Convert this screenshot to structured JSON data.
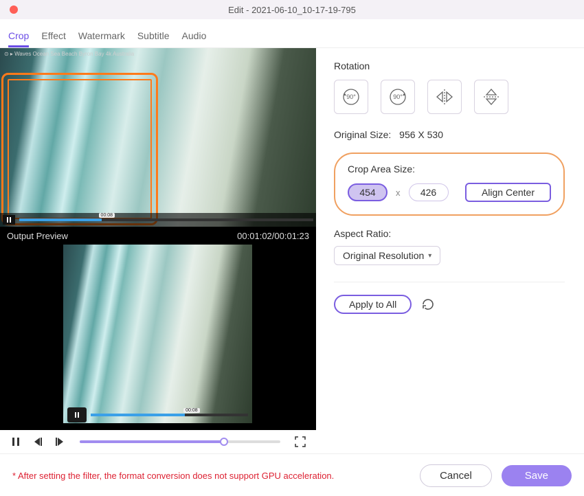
{
  "window": {
    "title": "Edit - 2021-06-10_10-17-19-795"
  },
  "tabs": {
    "crop": "Crop",
    "effect": "Effect",
    "watermark": "Watermark",
    "subtitle": "Subtitle",
    "audio": "Audio",
    "active": "crop"
  },
  "video_meta": "⊙ ▸ Waves Ocean Sea Beach Byron Bay 4k Australia",
  "timecode_marker": "00:08",
  "output_preview_label": "Output Preview",
  "timecode": "00:01:02/00:01:23",
  "rotation": {
    "label": "Rotation",
    "ccw": "90°",
    "cw": "90°"
  },
  "original_size": {
    "label": "Original Size:",
    "value": "956 X 530"
  },
  "crop_area": {
    "label": "Crop Area Size:",
    "width": "454",
    "height": "426",
    "sep": "x",
    "align": "Align Center"
  },
  "aspect": {
    "label": "Aspect Ratio:",
    "value": "Original Resolution"
  },
  "apply_all": "Apply to All",
  "footnote": "After setting the filter, the format conversion does not support GPU acceleration.",
  "buttons": {
    "cancel": "Cancel",
    "save": "Save"
  }
}
